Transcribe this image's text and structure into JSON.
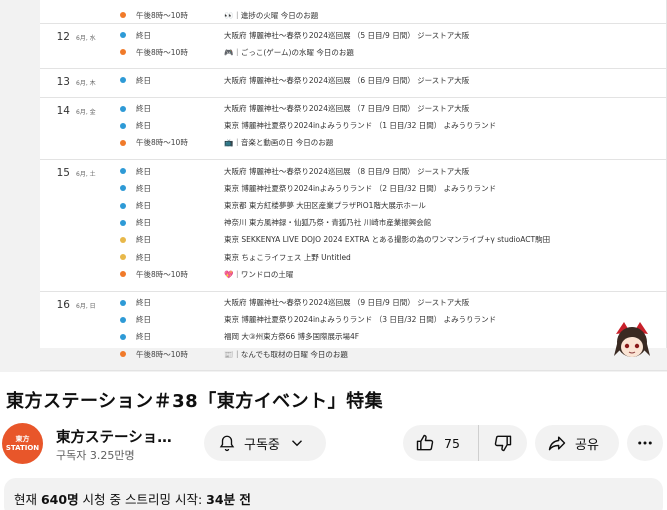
{
  "schedule": {
    "days": [
      {
        "num": "",
        "weekday": "",
        "events": [
          {
            "time": "午後8時〜10時",
            "icon": "eyes-icon",
            "title": "👀｜進捗の火曜 今日のお題",
            "color": "#f07a2a"
          }
        ]
      },
      {
        "num": "12",
        "weekday": "6月, 水",
        "events": [
          {
            "time": "終日",
            "title": "大阪府 博麗神社〜春祭り2024巡回展 （5 日目/9 日間） ジーストア大阪",
            "color": "#2e9ad6"
          },
          {
            "time": "午後8時〜10時",
            "icon": "game-controller-icon",
            "title": "🎮｜ごっこ(ゲーム)の水曜 今日のお題",
            "color": "#f07a2a"
          }
        ]
      },
      {
        "num": "13",
        "weekday": "6月, 木",
        "events": [
          {
            "time": "終日",
            "title": "大阪府 博麗神社〜春祭り2024巡回展 （6 日目/9 日間） ジーストア大阪",
            "color": "#2e9ad6"
          }
        ]
      },
      {
        "num": "14",
        "weekday": "6月, 金",
        "events": [
          {
            "time": "終日",
            "title": "大阪府 博麗神社〜春祭り2024巡回展 （7 日目/9 日間） ジーストア大阪",
            "color": "#2e9ad6"
          },
          {
            "time": "終日",
            "title": "東京 博麗神社夏祭り2024inよみうりランド （1 日目/32 日間） よみうりランド",
            "color": "#2e9ad6"
          },
          {
            "time": "午後8時〜10時",
            "icon": "music-icon",
            "title": "📺｜音楽と動画の日 今日のお題",
            "color": "#f07a2a"
          }
        ]
      },
      {
        "num": "15",
        "weekday": "6月, 土",
        "events": [
          {
            "time": "終日",
            "title": "大阪府 博麗神社〜春祭り2024巡回展 （8 日目/9 日間） ジーストア大阪",
            "color": "#2e9ad6"
          },
          {
            "time": "終日",
            "title": "東京 博麗神社夏祭り2024inよみうりランド （2 日目/32 日間） よみうりランド",
            "color": "#2e9ad6"
          },
          {
            "time": "終日",
            "title": "東京都 東方紅楼夢夢 大田区産業プラザPiO1階大展示ホール",
            "color": "#2e9ad6"
          },
          {
            "time": "終日",
            "title": "神奈川 東方風神録・仙狐乃祭・青狐乃社 川崎市産業振興会館",
            "color": "#2e9ad6"
          },
          {
            "time": "終日",
            "title": "東京 SEKKENYA LIVE DOJO 2024 EXTRA とある撮影の為のワンマンライブ+γ studioACT駒田",
            "color": "#e8b84a"
          },
          {
            "time": "終日",
            "title": "東京 ちょこライフェス 上野 Untitled",
            "color": "#e8b84a"
          },
          {
            "time": "午後8時〜10時",
            "icon": "heart-icon",
            "title": "💖｜ワンドロの土曜",
            "color": "#f07a2a"
          }
        ]
      },
      {
        "num": "16",
        "weekday": "6月, 日",
        "events": [
          {
            "time": "終日",
            "title": "大阪府 博麗神社〜春祭り2024巡回展 （9 日目/9 日間） ジーストア大阪",
            "color": "#2e9ad6"
          },
          {
            "time": "終日",
            "title": "東京 博麗神社夏祭り2024inよみうりランド （3 日目/32 日間） よみうりランド",
            "color": "#2e9ad6"
          },
          {
            "time": "終日",
            "title": "福岡 大③州東方祭66 博多国際展示場4F",
            "color": "#2e9ad6"
          },
          {
            "time": "午後8時〜10時",
            "icon": "news-icon",
            "title": "📰｜なんでも取材の日曜 今日のお題",
            "color": "#f07a2a"
          }
        ]
      }
    ]
  },
  "video": {
    "title": "東方ステーション＃38「東方イベント」特集"
  },
  "channel": {
    "avatar_line1": "東方",
    "avatar_line2": "STATION",
    "name": "東方ステーショ…",
    "subscribers": "구독자 3.25만명"
  },
  "actions": {
    "subscribe_label": "구독중",
    "like_count": "75",
    "share_label": "공유"
  },
  "description": {
    "viewers_prefix": "현재 ",
    "viewers_count": "640명",
    "viewers_suffix": " 시청 중  스트리밍 시작: ",
    "started_ago": "34분 전"
  },
  "colors": {
    "accent_orange": "#f07a2a",
    "accent_blue": "#2e9ad6",
    "accent_yellow": "#e8b84a",
    "avatar_bg": "#e8562a"
  }
}
